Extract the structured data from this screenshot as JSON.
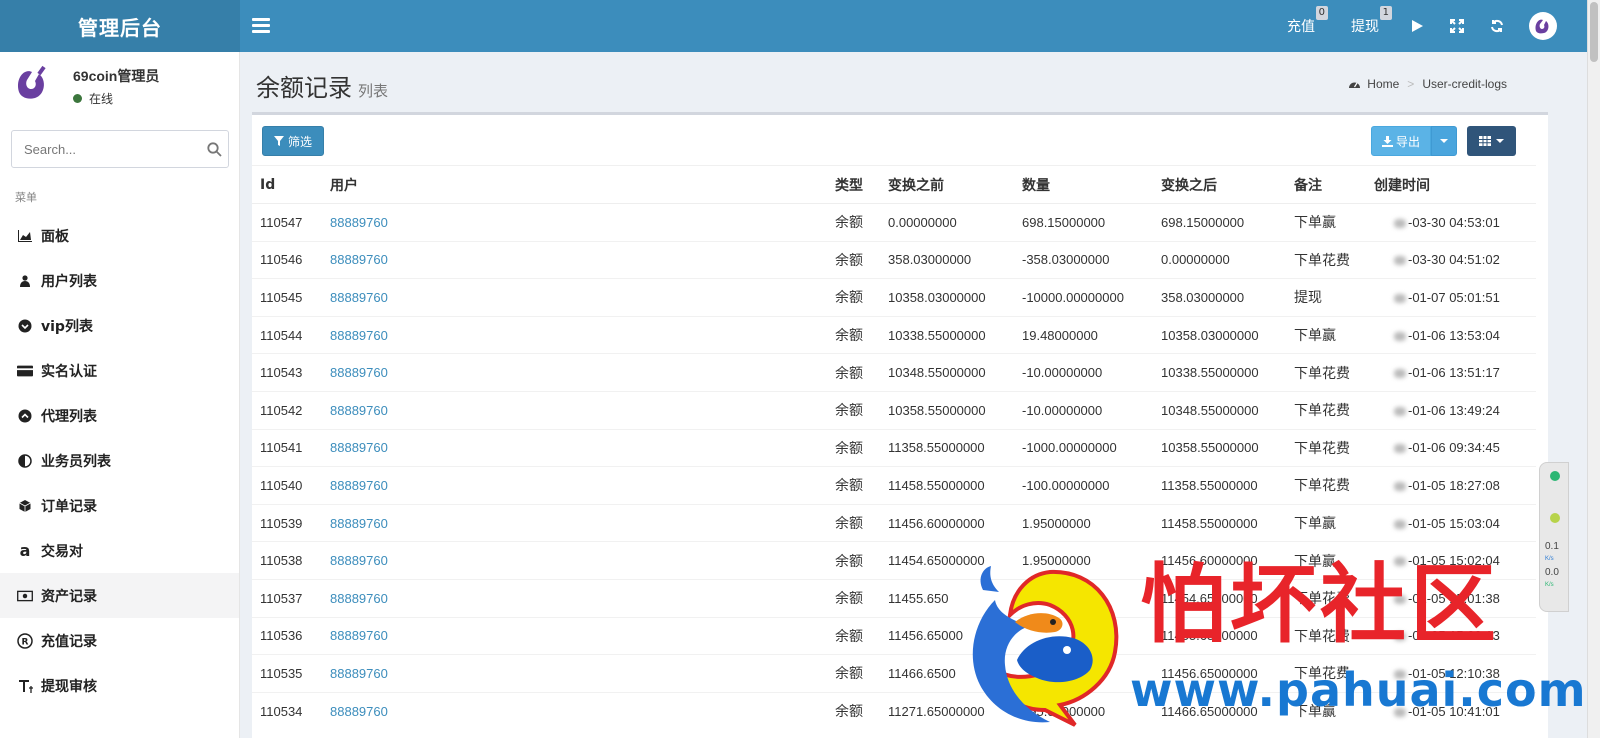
{
  "header": {
    "brand": "管理后台",
    "links": [
      {
        "label": "充值",
        "badge": "0"
      },
      {
        "label": "提现",
        "badge": "1"
      }
    ],
    "icons": [
      "play-icon",
      "expand-icon",
      "refresh-icon",
      "avatar"
    ]
  },
  "sidebar": {
    "user_name": "69coin管理员",
    "user_status": "在线",
    "search_placeholder": "Search...",
    "menu_header": "菜单",
    "items": [
      {
        "label": "面板",
        "icon": "area-chart-icon"
      },
      {
        "label": "用户列表",
        "icon": "users-icon"
      },
      {
        "label": "vip列表",
        "icon": "chevron-circle-down-icon"
      },
      {
        "label": "实名认证",
        "icon": "credit-card-icon"
      },
      {
        "label": "代理列表",
        "icon": "chevron-circle-up-icon"
      },
      {
        "label": "业务员列表",
        "icon": "adjust-icon"
      },
      {
        "label": "订单记录",
        "icon": "cube-icon"
      },
      {
        "label": "交易对",
        "icon": "amazon-icon"
      },
      {
        "label": "资产记录",
        "icon": "money-icon",
        "active": true
      },
      {
        "label": "充值记录",
        "icon": "registered-icon"
      },
      {
        "label": "提现审核",
        "icon": "text-height-icon"
      }
    ]
  },
  "content": {
    "title": "余额记录",
    "subtitle": "列表",
    "breadcrumb": [
      "Home",
      "User-credit-logs"
    ],
    "filter_label": "筛选",
    "export_label": "导出",
    "columns": [
      "Id",
      "用户",
      "类型",
      "变换之前",
      "数量",
      "变换之后",
      "备注",
      "创建时间"
    ],
    "rows": [
      [
        "110547",
        "88889760",
        "余额",
        "0.00000000",
        "698.15000000",
        "698.15000000",
        "下单赢",
        "-03-30 04:53:01"
      ],
      [
        "110546",
        "88889760",
        "余额",
        "358.03000000",
        "-358.03000000",
        "0.00000000",
        "下单花费",
        "-03-30 04:51:02"
      ],
      [
        "110545",
        "88889760",
        "余额",
        "10358.03000000",
        "-10000.00000000",
        "358.03000000",
        "提现",
        "-01-07 05:01:51"
      ],
      [
        "110544",
        "88889760",
        "余额",
        "10338.55000000",
        "19.48000000",
        "10358.03000000",
        "下单赢",
        "-01-06 13:53:04"
      ],
      [
        "110543",
        "88889760",
        "余额",
        "10348.55000000",
        "-10.00000000",
        "10338.55000000",
        "下单花费",
        "-01-06 13:51:17"
      ],
      [
        "110542",
        "88889760",
        "余额",
        "10358.55000000",
        "-10.00000000",
        "10348.55000000",
        "下单花费",
        "-01-06 13:49:24"
      ],
      [
        "110541",
        "88889760",
        "余额",
        "11358.55000000",
        "-1000.00000000",
        "10358.55000000",
        "下单花费",
        "-01-06 09:34:45"
      ],
      [
        "110540",
        "88889760",
        "余额",
        "11458.55000000",
        "-100.00000000",
        "11358.55000000",
        "下单花费",
        "-01-05 18:27:08"
      ],
      [
        "110539",
        "88889760",
        "余额",
        "11456.60000000",
        "1.95000000",
        "11458.55000000",
        "下单赢",
        "-01-05 15:03:04"
      ],
      [
        "110538",
        "88889760",
        "余额",
        "11454.65000000",
        "1.95000000",
        "11456.60000000",
        "下单赢",
        "-01-05 15:02:04"
      ],
      [
        "110537",
        "88889760",
        "余额",
        "11455.650",
        "",
        "11454.65000000",
        "下单花费",
        "-01-05 15:01:38"
      ],
      [
        "110536",
        "88889760",
        "余额",
        "11456.65000",
        "",
        "11455.65000000",
        "下单花费",
        "-01-05 15:00:13"
      ],
      [
        "110535",
        "88889760",
        "余额",
        "11466.6500",
        "",
        "11456.65000000",
        "下单花费",
        "-01-05 12:10:38"
      ],
      [
        "110534",
        "88889760",
        "余额",
        "11271.65000000",
        "195.00000000",
        "11466.65000000",
        "下单赢",
        "-01-05 10:41:01"
      ]
    ]
  },
  "widget": {
    "up": "0.1",
    "down": "0.0",
    "unit": "K/s"
  },
  "watermark": {
    "title": "怕坏社区",
    "url": "www.pahuai.com"
  },
  "colors": {
    "header": "#3c8dbc",
    "brand_bg": "#367fa9",
    "link": "#3c8dbc",
    "watermark_red": "#e8242a",
    "watermark_blue": "#1878d2"
  }
}
